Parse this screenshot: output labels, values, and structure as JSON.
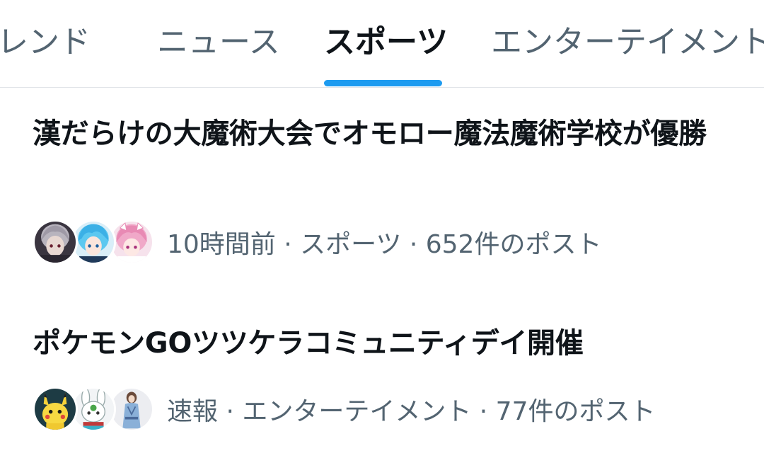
{
  "tabs": [
    {
      "label": "トレンド",
      "active": false
    },
    {
      "label": "ニュース",
      "active": false
    },
    {
      "label": "スポーツ",
      "active": true
    },
    {
      "label": "エンターテイメント",
      "active": false
    }
  ],
  "colors": {
    "accent": "#1d9bf0",
    "text_primary": "#0f1419",
    "text_secondary": "#536471",
    "divider": "#e1e4e8"
  },
  "trends": [
    {
      "title": "漢だらけの大魔術大会でオモロー魔法魔術学校が優勝",
      "meta": "10時間前 · スポーツ · 652件のポスト",
      "avatars": [
        "avatar-gray-hair-character",
        "avatar-blue-hair-character",
        "avatar-pink-hair-character"
      ]
    },
    {
      "title": "ポケモンGOツツケラコミュニティデイ開催",
      "meta": "速報 · エンターテイメント · 77件のポスト",
      "avatars": [
        "avatar-pikachu",
        "avatar-white-rabbit",
        "avatar-blue-outfit-figure"
      ]
    }
  ]
}
